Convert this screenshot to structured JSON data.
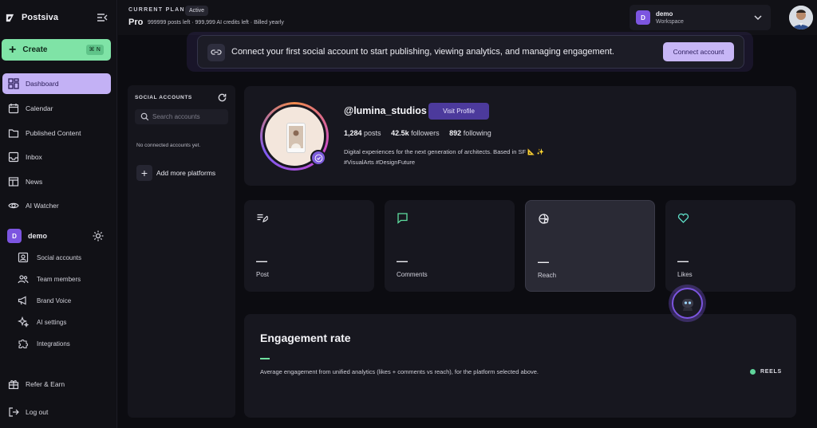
{
  "brand": {
    "name": "Postsiva"
  },
  "sidebar": {
    "create_label": "Create",
    "create_shortcut": "⌘ N",
    "nav": [
      {
        "label": "Dashboard",
        "icon": "dashboard-icon"
      },
      {
        "label": "Calendar",
        "icon": "calendar-icon"
      },
      {
        "label": "Published Content",
        "icon": "folder-icon"
      },
      {
        "label": "Inbox",
        "icon": "inbox-icon"
      },
      {
        "label": "News",
        "icon": "news-icon"
      },
      {
        "label": "AI Watcher",
        "icon": "eye-icon"
      }
    ],
    "workspace": {
      "initial": "D",
      "name": "demo"
    },
    "workspace_items": [
      {
        "label": "Social accounts",
        "icon": "account-card-icon"
      },
      {
        "label": "Team members",
        "icon": "team-icon"
      },
      {
        "label": "Brand Voice",
        "icon": "megaphone-icon"
      },
      {
        "label": "AI settings",
        "icon": "sparkles-icon"
      },
      {
        "label": "Integrations",
        "icon": "puzzle-icon"
      }
    ],
    "footer": [
      {
        "label": "Refer & Earn",
        "icon": "gift-icon"
      },
      {
        "label": "Log out",
        "icon": "logout-icon"
      }
    ]
  },
  "topbar": {
    "plan_kicker": "CURRENT PLAN",
    "plan_status": "Active",
    "plan_name": "Pro",
    "plan_detail": "999999 posts left · 999,999 AI credits left · Billed yearly",
    "workspace_name": "demo",
    "workspace_sub": "Workspace",
    "workspace_initial": "D"
  },
  "banner": {
    "text": "Connect your first social account to start publishing, viewing analytics, and managing engagement.",
    "button": "Connect account"
  },
  "accounts_panel": {
    "title": "SOCIAL ACCOUNTS",
    "search_placeholder": "Search accounts",
    "empty_text": "No connected accounts yet.",
    "add_label": "Add more platforms"
  },
  "profile": {
    "handle": "@lumina_studios",
    "visit_label": "Visit Profile",
    "posts": "1,284",
    "posts_label": "posts",
    "followers": "42.5k",
    "followers_label": "followers",
    "following": "892",
    "following_label": "following",
    "bio_line1": "Digital experiences for the next generation of architects. Based in SF 📐 ✨",
    "bio_line2": "#VisualArts #DesignFuture"
  },
  "metrics": [
    {
      "label": "Post",
      "value": "—",
      "icon": "edit-list-icon",
      "color": "#e8e8ee"
    },
    {
      "label": "Comments",
      "value": "—",
      "icon": "comment-icon",
      "color": "#5fe0a0"
    },
    {
      "label": "Reach",
      "value": "—",
      "icon": "reach-icon",
      "color": "#e8e8ee"
    },
    {
      "label": "Likes",
      "value": "—",
      "icon": "heart-icon",
      "color": "#5fe0c8"
    }
  ],
  "engagement": {
    "title": "Engagement rate",
    "description": "Average engagement from unified analytics (likes + comments vs reach), for the platform selected above.",
    "filter_label": "REELS"
  }
}
